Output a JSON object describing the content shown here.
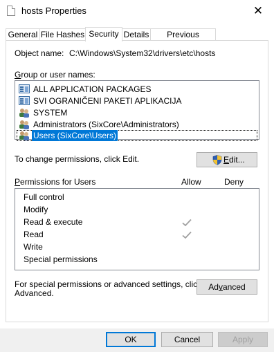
{
  "window": {
    "title": "hosts Properties",
    "close_glyph": "✕"
  },
  "tabs": [
    {
      "label": "General"
    },
    {
      "label": "File Hashes"
    },
    {
      "label": "Security"
    },
    {
      "label": "Details"
    },
    {
      "label": "Previous Versions"
    }
  ],
  "active_tab": "Security",
  "object": {
    "label": "Object name:",
    "value": "C:\\Windows\\System32\\drivers\\etc\\hosts"
  },
  "groups": {
    "label": "Group or user names:",
    "items": [
      {
        "label": "ALL APPLICATION PACKAGES",
        "icon": "app-package-icon"
      },
      {
        "label": "SVI OGRANIČENI PAKETI APLIKACIJA",
        "icon": "app-package-icon"
      },
      {
        "label": "SYSTEM",
        "icon": "users-group-icon"
      },
      {
        "label": "Administrators (SixCore\\Administrators)",
        "icon": "users-group-icon"
      },
      {
        "label": "Users (SixCore\\Users)",
        "icon": "users-group-icon",
        "selected": true
      }
    ]
  },
  "change_text": "To change permissions, click Edit.",
  "edit_button": {
    "accel": "E",
    "rest": "dit..."
  },
  "permissions": {
    "header": "Permissions for Users",
    "allow": "Allow",
    "deny": "Deny",
    "rows": [
      {
        "label": "Full control",
        "allow": false,
        "deny": false
      },
      {
        "label": "Modify",
        "allow": false,
        "deny": false
      },
      {
        "label": "Read & execute",
        "allow": true,
        "deny": false
      },
      {
        "label": "Read",
        "allow": true,
        "deny": false
      },
      {
        "label": "Write",
        "allow": false,
        "deny": false
      },
      {
        "label": "Special permissions",
        "allow": false,
        "deny": false
      }
    ]
  },
  "special_text": {
    "line1": "For special permissions or advanced settings, click",
    "line2": "Advanced."
  },
  "advanced_button": {
    "pre": "Ad",
    "accel": "v",
    "post": "anced"
  },
  "footer": {
    "ok": "OK",
    "cancel": "Cancel",
    "apply": "Apply"
  },
  "colors": {
    "selection": "#0078d7",
    "check": "#a0a0a0",
    "border": "#828790"
  }
}
